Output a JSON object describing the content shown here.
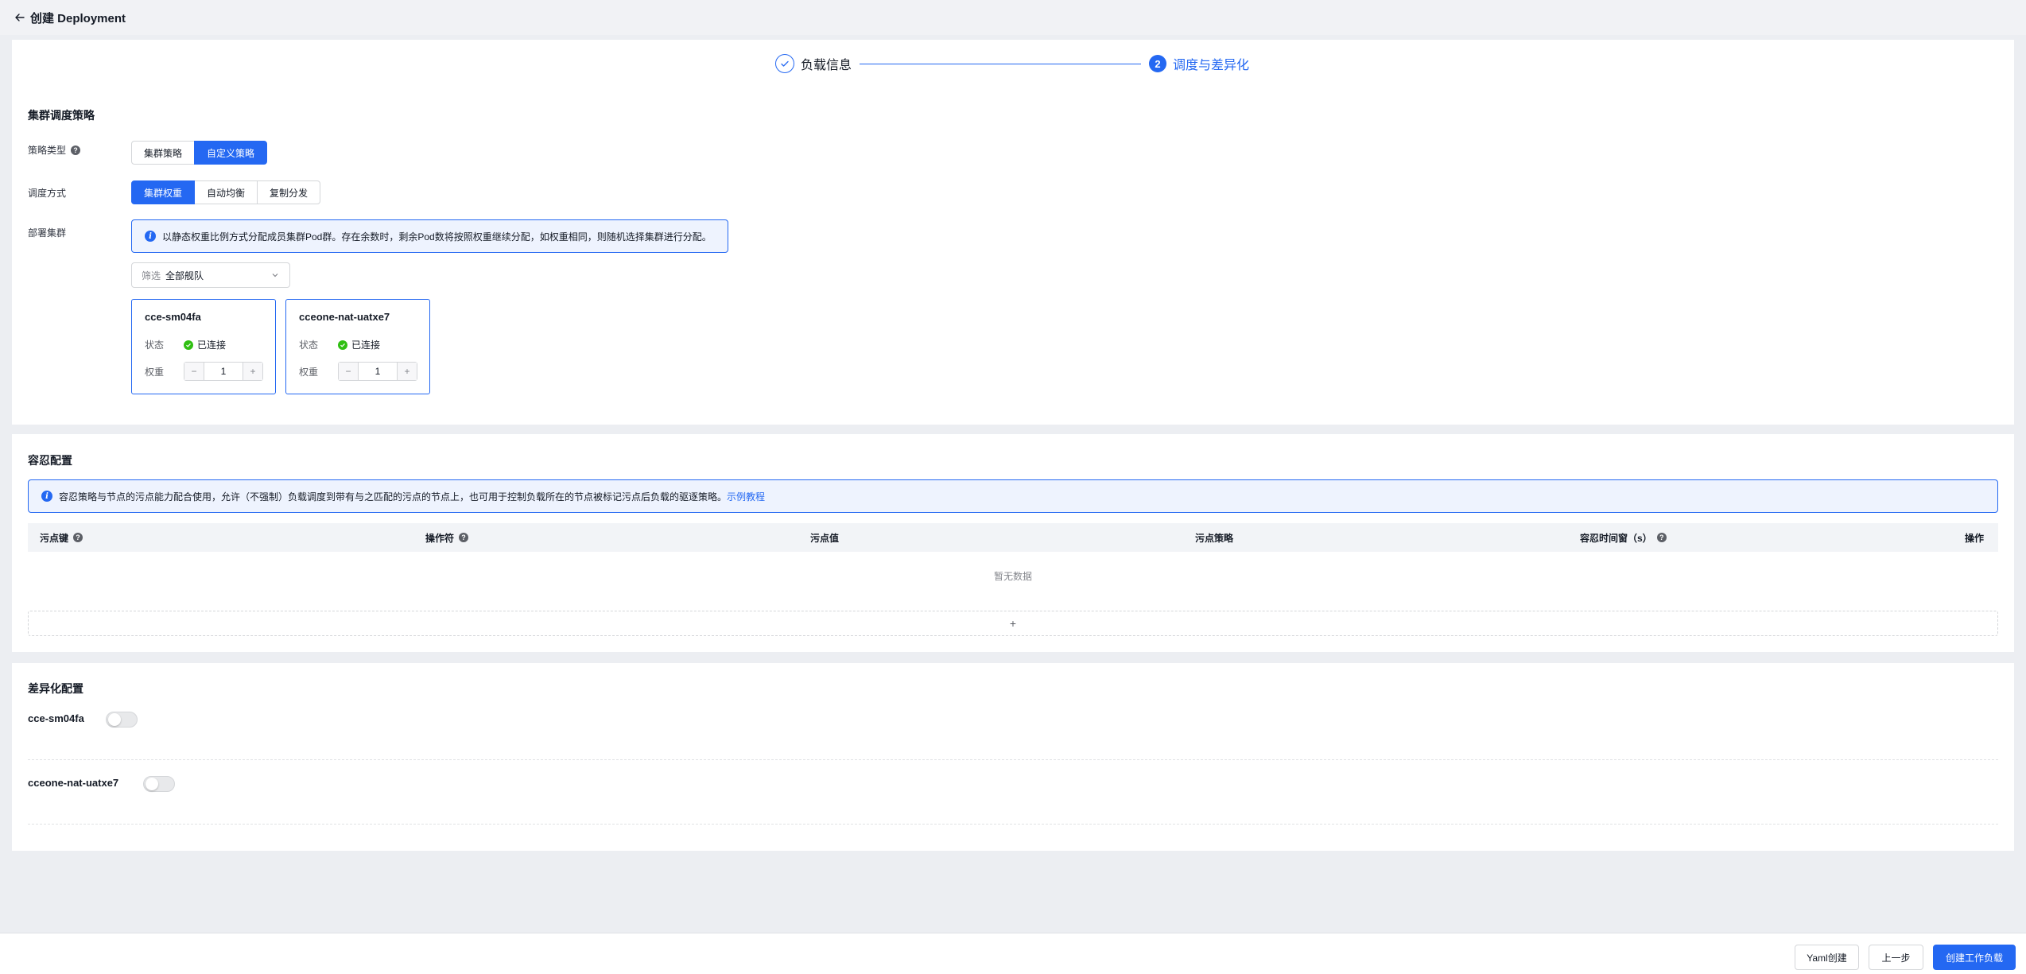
{
  "header": {
    "title": "创建 Deployment"
  },
  "stepper": {
    "steps": [
      {
        "label": "负载信息",
        "state": "done"
      },
      {
        "number": "2",
        "label": "调度与差异化",
        "state": "active"
      }
    ]
  },
  "scheduling": {
    "title": "集群调度策略",
    "policy_type": {
      "label": "策略类型",
      "options": [
        "集群策略",
        "自定义策略"
      ],
      "selected": "自定义策略"
    },
    "schedule_mode": {
      "label": "调度方式",
      "options": [
        "集群权重",
        "自动均衡",
        "复制分发"
      ],
      "selected": "集群权重"
    },
    "deploy_clusters": {
      "label": "部署集群",
      "info": "以静态权重比例方式分配成员集群Pod群。存在余数时，剩余Pod数将按照权重继续分配，如权重相同，则随机选择集群进行分配。",
      "filter": {
        "prefix": "筛选",
        "value": "全部舰队"
      },
      "clusters": [
        {
          "name": "cce-sm04fa",
          "status_label": "状态",
          "status": "已连接",
          "weight_label": "权重",
          "weight": "1"
        },
        {
          "name": "cceone-nat-uatxe7",
          "status_label": "状态",
          "status": "已连接",
          "weight_label": "权重",
          "weight": "1"
        }
      ]
    }
  },
  "toleration": {
    "title": "容忍配置",
    "info": "容忍策略与节点的污点能力配合使用，允许（不强制）负载调度到带有与之匹配的污点的节点上，也可用于控制负载所在的节点被标记污点后负载的驱逐策略。",
    "info_link": "示例教程",
    "columns": [
      "污点键",
      "操作符",
      "污点值",
      "污点策略",
      "容忍时间窗（s）",
      "操作"
    ],
    "empty": "暂无数据",
    "add": "+"
  },
  "diff_config": {
    "title": "差异化配置",
    "clusters": [
      {
        "name": "cce-sm04fa",
        "enabled": false
      },
      {
        "name": "cceone-nat-uatxe7",
        "enabled": false
      }
    ]
  },
  "footer": {
    "yaml_button": "Yaml创建",
    "prev_button": "上一步",
    "create_button": "创建工作负载"
  },
  "colors": {
    "primary": "#2468f2",
    "success": "#30bf13",
    "background": "#eceef2"
  }
}
